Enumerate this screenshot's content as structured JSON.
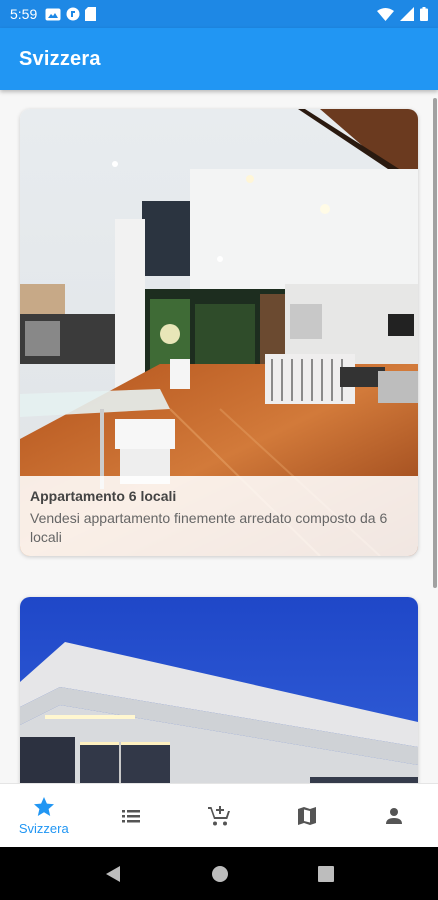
{
  "status_bar": {
    "time": "5:59",
    "left_icons": [
      "gallery-icon",
      "app-icon",
      "sd-card-icon"
    ],
    "right_icons": [
      "wifi-icon",
      "signal-icon",
      "battery-icon"
    ]
  },
  "app_bar": {
    "title": "Svizzera"
  },
  "listings": [
    {
      "title": "Appartamento 6 locali",
      "description": "Vendesi appartamento finemente arredato composto da 6 locali",
      "image": "luxury-interior-photo"
    },
    {
      "title": "",
      "description": "",
      "image": "modern-villa-exterior-photo"
    }
  ],
  "bottom_nav": {
    "items": [
      {
        "label": "Svizzera",
        "icon": "star-icon",
        "active": true
      },
      {
        "label": "",
        "icon": "list-icon",
        "active": false
      },
      {
        "label": "",
        "icon": "add-cart-icon",
        "active": false
      },
      {
        "label": "",
        "icon": "map-icon",
        "active": false
      },
      {
        "label": "",
        "icon": "person-icon",
        "active": false
      }
    ]
  },
  "colors": {
    "primary": "#2196f3",
    "status_bar": "#1e88e5",
    "inactive_icon": "#555555"
  }
}
